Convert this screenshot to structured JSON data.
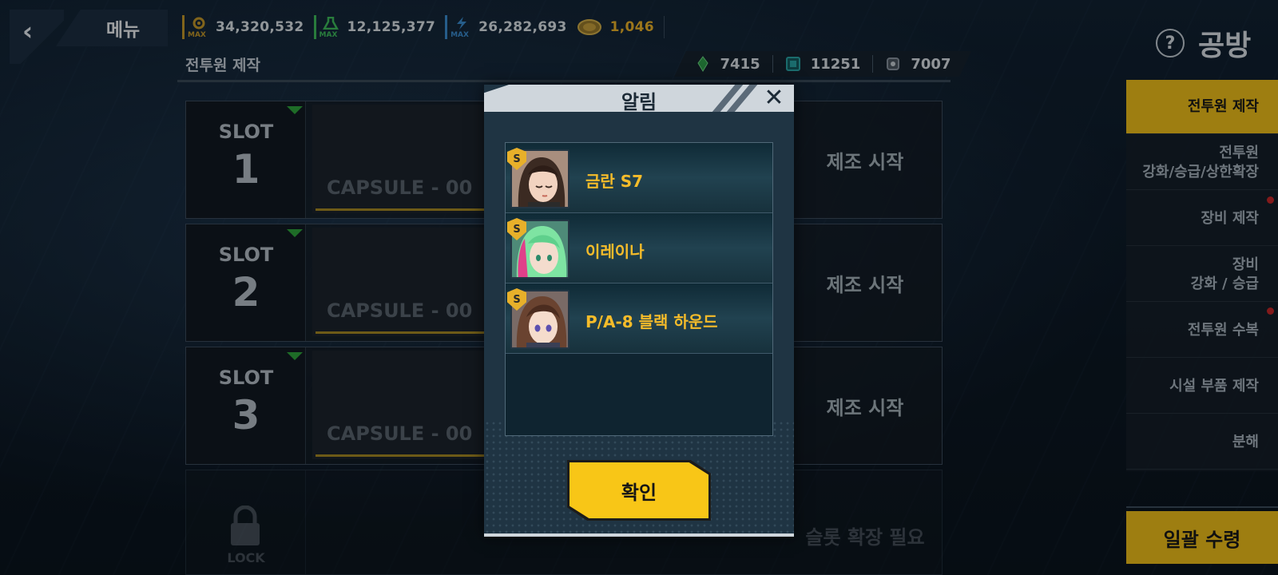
{
  "topbar": {
    "menu_label": "메뉴",
    "currencies": [
      {
        "icon": "gear-max-icon",
        "tag": "MAX",
        "value": "34,320,532",
        "color": "#c79a2a"
      },
      {
        "icon": "flask-max-icon",
        "tag": "MAX",
        "value": "12,125,377",
        "color": "#3fbf5d"
      },
      {
        "icon": "bolt-max-icon",
        "tag": "MAX",
        "value": "26,282,693",
        "color": "#3b8fd4"
      },
      {
        "icon": "coin-icon",
        "tag": "",
        "value": "1,046",
        "color": "#f0b62a"
      }
    ],
    "help_label": "?",
    "screen_title": "공방"
  },
  "section": {
    "title": "전투원 제작",
    "resources": [
      {
        "icon": "green-crystal-icon",
        "value": "7415",
        "color": "#2f9e4a"
      },
      {
        "icon": "chip-icon",
        "value": "11251",
        "color": "#2aa6a8"
      },
      {
        "icon": "gear-part-icon",
        "value": "7007",
        "color": "#7f8a95"
      }
    ]
  },
  "slots": [
    {
      "label": "SLOT",
      "number": "1",
      "capsule": "CAPSULE - 00",
      "action": "제조 시작"
    },
    {
      "label": "SLOT",
      "number": "2",
      "capsule": "CAPSULE - 00",
      "action": "제조 시작"
    },
    {
      "label": "SLOT",
      "number": "3",
      "capsule": "CAPSULE - 00",
      "action": "제조 시작"
    }
  ],
  "locked_slot": {
    "lock_label": "LOCK",
    "action": "슬롯 확장 필요"
  },
  "sidebar": {
    "items": [
      {
        "label": "전투원 제작",
        "active": true,
        "dot": false
      },
      {
        "label": "전투원\n강화/승급/상한확장",
        "active": false,
        "dot": false
      },
      {
        "label": "장비 제작",
        "active": false,
        "dot": true
      },
      {
        "label": "장비\n강화 / 승급",
        "active": false,
        "dot": false
      },
      {
        "label": "전투원 수복",
        "active": false,
        "dot": true
      },
      {
        "label": "시설 부품 제작",
        "active": false,
        "dot": false
      },
      {
        "label": "분해",
        "active": false,
        "dot": false
      }
    ],
    "bulk_label": "일괄 수령"
  },
  "modal": {
    "title": "알림",
    "close_label": "✕",
    "items": [
      {
        "grade": "S",
        "name": "금란 S7",
        "hair": "#3b2a22",
        "skin": "#f2d3c0",
        "accent": "#2d1d17"
      },
      {
        "grade": "S",
        "name": "이레이나",
        "hair": "#7ee4a2",
        "skin": "#f4dccd",
        "accent": "#e0408a"
      },
      {
        "grade": "S",
        "name": "P/A-8 블랙 하운드",
        "hair": "#6a4330",
        "skin": "#f5dccc",
        "accent": "#4b2c1f"
      }
    ],
    "confirm_label": "확인"
  }
}
